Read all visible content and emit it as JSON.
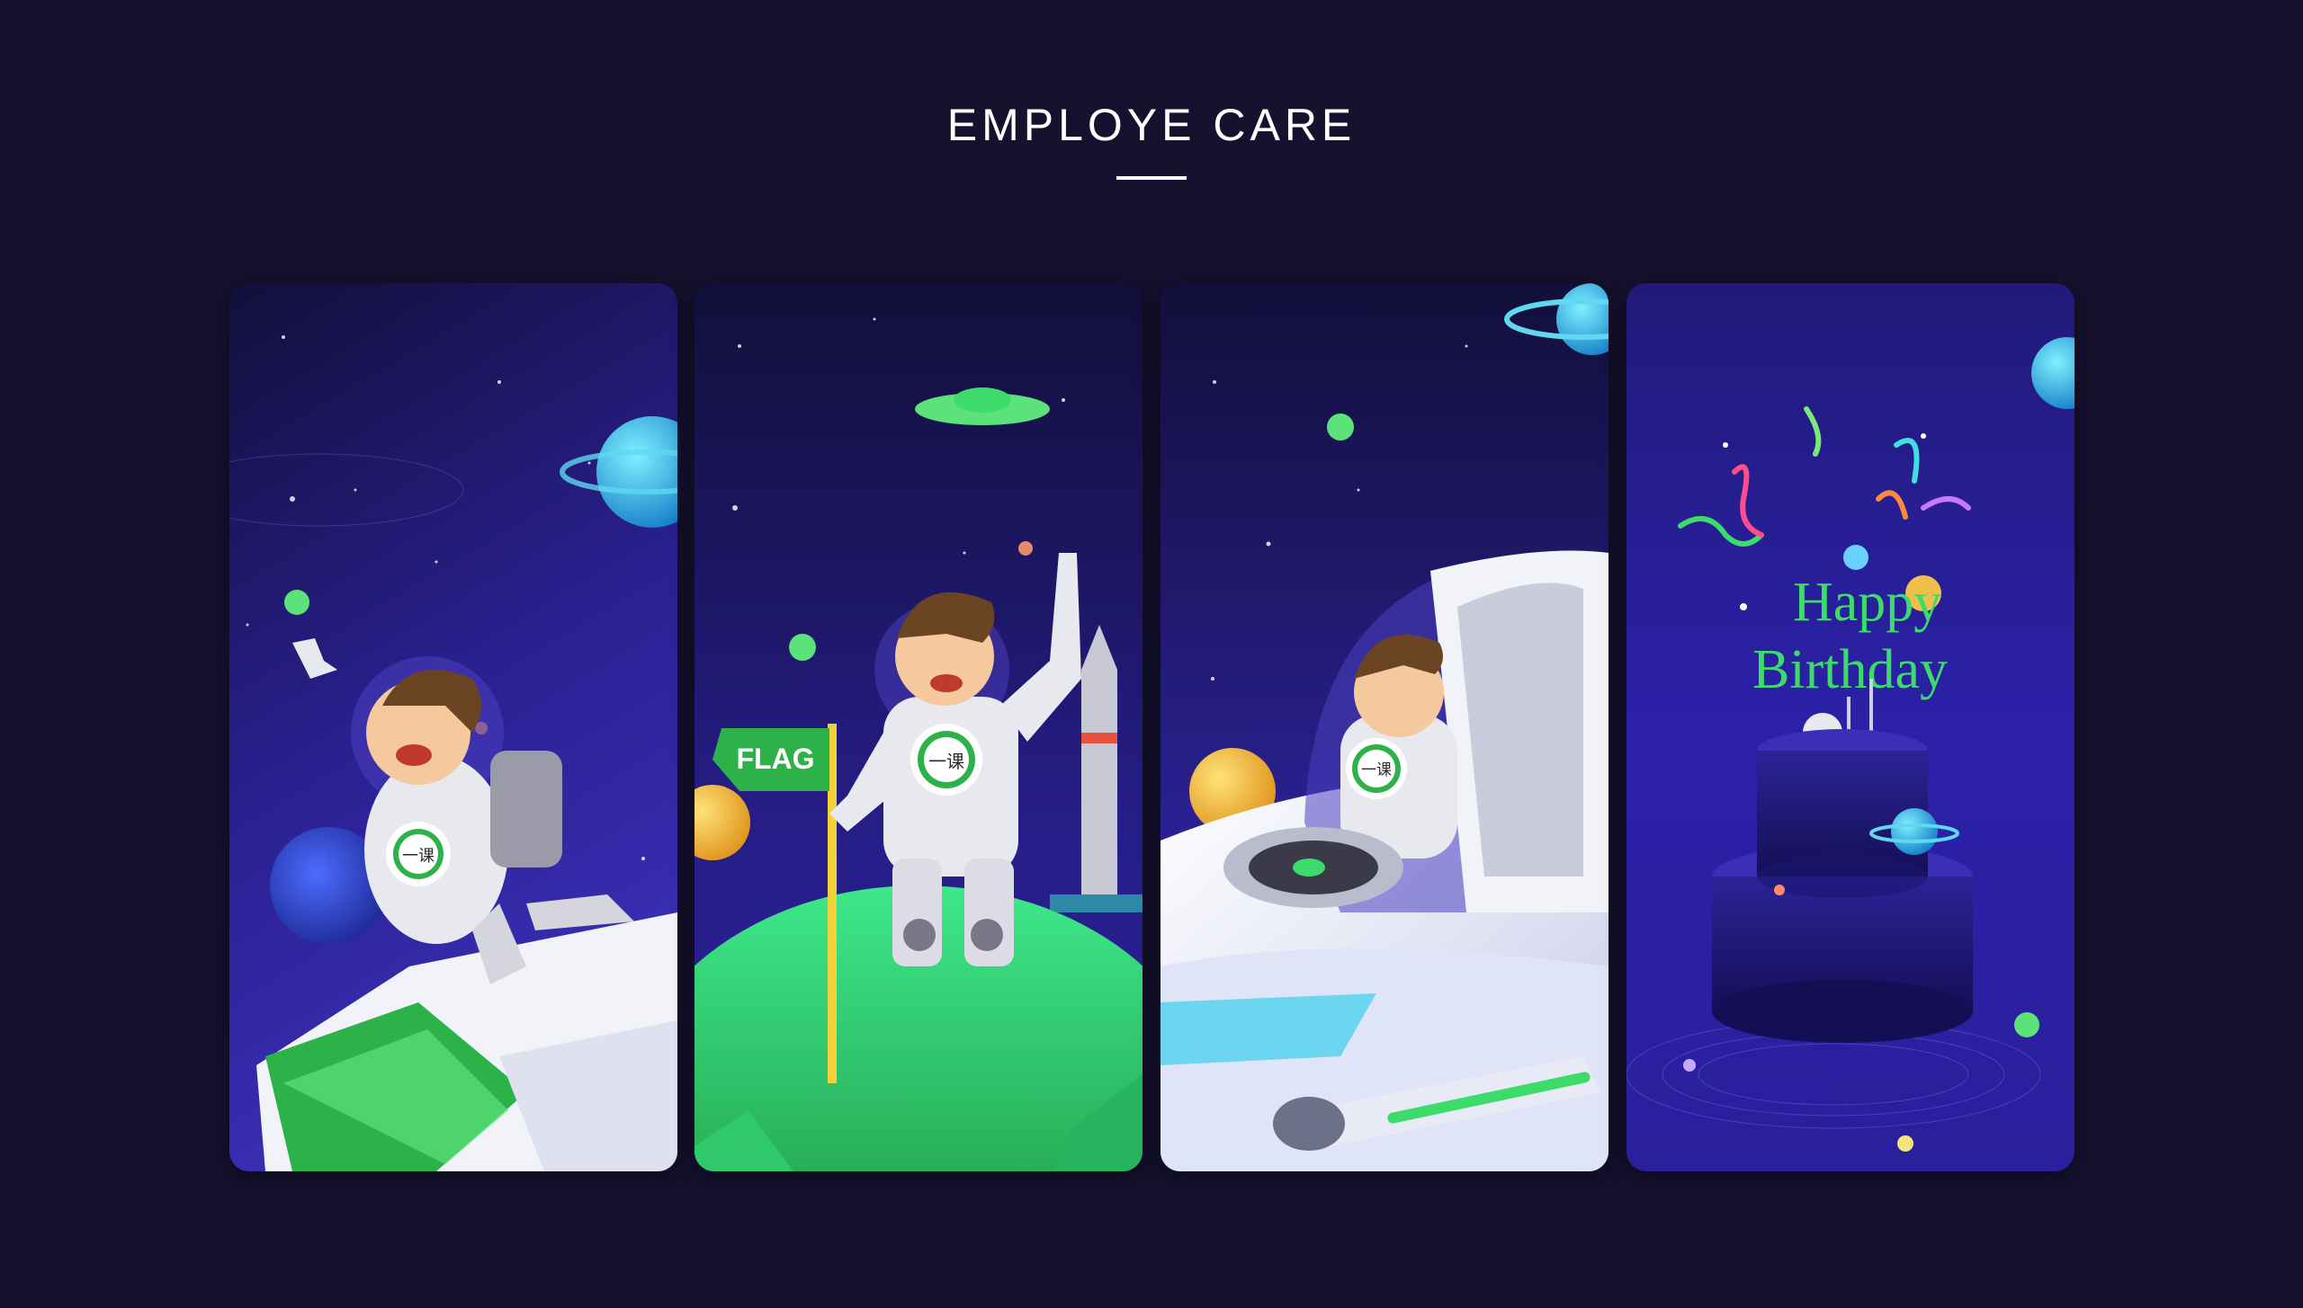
{
  "header": {
    "title": "EMPLOYE CARE"
  },
  "panels": [
    {
      "scene": "astronaut-on-book"
    },
    {
      "scene": "astronaut-with-flag",
      "flag_label": "FLAG",
      "badge_label": "一课"
    },
    {
      "scene": "astronaut-in-spaceship",
      "badge_label": "一课"
    },
    {
      "scene": "birthday-cake",
      "greeting_line1": "Happy",
      "greeting_line2": "Birthday"
    }
  ],
  "panel1": {
    "badge_label": "一课"
  },
  "colors": {
    "background": "#15112f",
    "space_deep": "#1a1456",
    "space_light": "#3a2aa8",
    "accent_green": "#3ddc6a",
    "planet_cyan": "#34c6e8",
    "suit": "#e8e8ef"
  }
}
